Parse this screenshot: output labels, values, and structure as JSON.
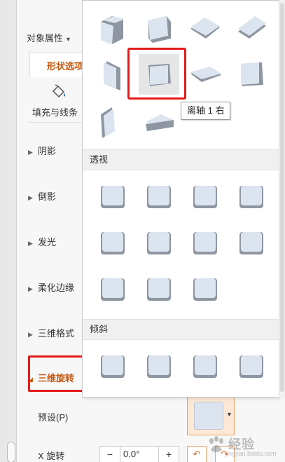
{
  "pane": {
    "title": "对象属性",
    "tab_shape": "形状选项",
    "fill_line": "填充与线条",
    "sections": [
      "阴影",
      "倒影",
      "发光",
      "柔化边缘",
      "三维格式",
      "三维旋转"
    ],
    "preset_label": "预设(P)",
    "x_rotation_label": "X 旋转",
    "x_rotation_value": "0.0°",
    "minus": "−",
    "plus": "+"
  },
  "gallery": {
    "categories": [
      "透视",
      "倾斜"
    ],
    "tooltip": "离轴 1 右"
  },
  "colors": {
    "accent": "#c55a11",
    "highlight_red": "#e31b1b",
    "face": "#dbe4ef",
    "edge": "#8e96a2"
  },
  "watermark": {
    "text": "经验",
    "url": "jingyan.baidu.com"
  }
}
